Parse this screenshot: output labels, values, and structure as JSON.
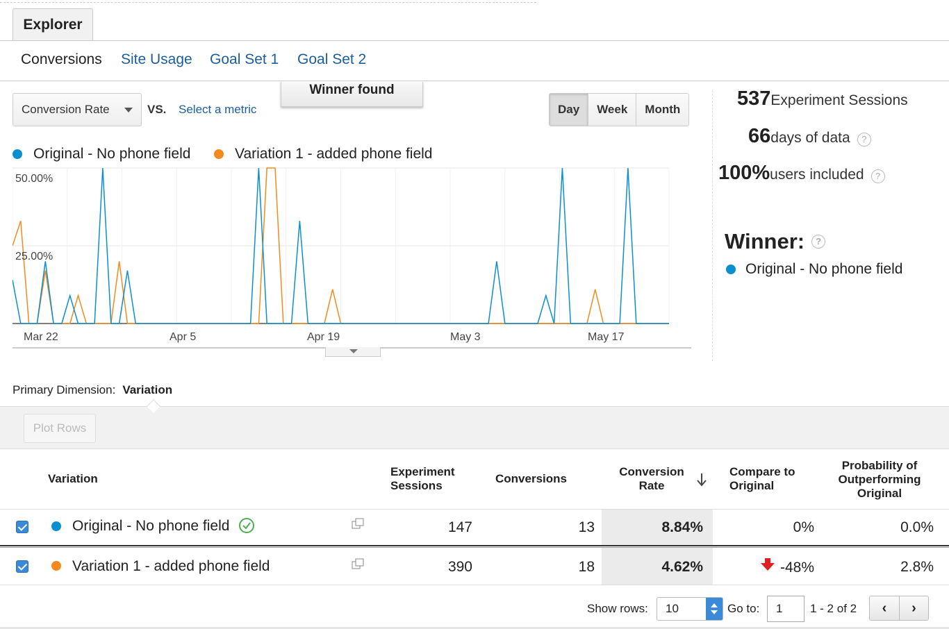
{
  "tabs": {
    "explorer": "Explorer"
  },
  "subtabs": [
    "Conversions",
    "Site Usage",
    "Goal Set 1",
    "Goal Set 2"
  ],
  "controls": {
    "metric": "Conversion Rate",
    "vs": "VS.",
    "select_metric": "Select a metric",
    "winner_found": "Winner found",
    "periods": [
      "Day",
      "Week",
      "Month"
    ],
    "active_period": "Day"
  },
  "legend": [
    {
      "label": "Original - No phone field",
      "color": "#0b8fd0"
    },
    {
      "label": "Variation 1 - added phone field",
      "color": "#f28a1e"
    }
  ],
  "stats": {
    "sessions_value": "537",
    "sessions_label": "Experiment Sessions",
    "days_value": "66",
    "days_label": "days of data",
    "users_value": "100%",
    "users_label": "users included",
    "help_glyph": "?"
  },
  "winner": {
    "label": "Winner:",
    "value": "Original - No phone field"
  },
  "chart_data": {
    "type": "line",
    "x_tick_labels": [
      "Mar 22",
      "Apr 5",
      "Apr 19",
      "May 3",
      "May 17"
    ],
    "y_tick_labels": [
      "50.00%",
      "25.00%"
    ],
    "ylim": [
      0,
      50
    ],
    "grid": true,
    "legend_placement": "top-left",
    "series": [
      {
        "name": "Original - No phone field",
        "color": "#0b8fd0",
        "values": [
          14,
          0,
          0,
          0,
          20,
          0,
          0,
          9,
          0,
          0,
          0,
          50,
          0,
          0,
          17,
          0,
          0,
          0,
          0,
          0,
          0,
          0,
          0,
          0,
          0,
          0,
          0,
          0,
          0,
          0,
          50,
          0,
          0,
          0,
          0,
          33,
          0,
          0,
          0,
          0,
          0,
          0,
          0,
          0,
          0,
          0,
          0,
          0,
          0,
          0,
          0,
          0,
          0,
          0,
          0,
          0,
          0,
          0,
          0,
          20,
          0,
          0,
          0,
          0,
          0,
          9,
          0,
          50,
          0,
          0,
          0,
          0,
          0,
          0,
          0,
          50,
          0,
          0,
          0,
          0,
          0
        ]
      },
      {
        "name": "Variation 1 - added phone field",
        "color": "#f28a1e",
        "values": [
          25,
          33,
          0,
          0,
          17,
          0,
          0,
          0,
          9,
          0,
          0,
          0,
          0,
          20,
          0,
          0,
          0,
          0,
          0,
          0,
          0,
          0,
          0,
          0,
          0,
          0,
          0,
          0,
          0,
          0,
          0,
          50,
          50,
          0,
          0,
          0,
          0,
          0,
          0,
          11,
          0,
          0,
          0,
          0,
          0,
          0,
          0,
          0,
          0,
          0,
          0,
          0,
          0,
          0,
          0,
          0,
          0,
          0,
          0,
          0,
          0,
          0,
          0,
          0,
          0,
          0,
          0,
          0,
          0,
          0,
          0,
          11,
          0,
          0,
          0,
          0,
          0,
          0,
          0,
          0,
          0
        ]
      }
    ]
  },
  "dimension": {
    "label": "Primary Dimension:",
    "value": "Variation"
  },
  "plot_rows": "Plot Rows",
  "table": {
    "headers": {
      "variation": "Variation",
      "sessions": "Experiment Sessions",
      "conversions": "Conversions",
      "rate": "Conversion Rate",
      "compare": "Compare to Original",
      "probability": "Probability of Outperforming Original"
    },
    "rows": [
      {
        "name": "Original - No phone field",
        "color": "#0b8fd0",
        "sessions": "147",
        "conversions": "13",
        "rate": "8.84%",
        "compare": "0%",
        "probability": "0.0%",
        "winner": true
      },
      {
        "name": "Variation 1 - added phone field",
        "color": "#f28a1e",
        "sessions": "390",
        "conversions": "18",
        "rate": "4.62%",
        "compare": "-48%",
        "probability": "2.8%",
        "winner": false
      }
    ]
  },
  "footer": {
    "show_rows_label": "Show rows:",
    "show_rows_value": "10",
    "goto_label": "Go to:",
    "goto_value": "1",
    "range": "1 - 2 of 2",
    "prev": "‹",
    "next": "›"
  },
  "colors": {
    "link": "#1a5e9e",
    "negative": "#e02020",
    "winner_check": "#4caf50"
  }
}
